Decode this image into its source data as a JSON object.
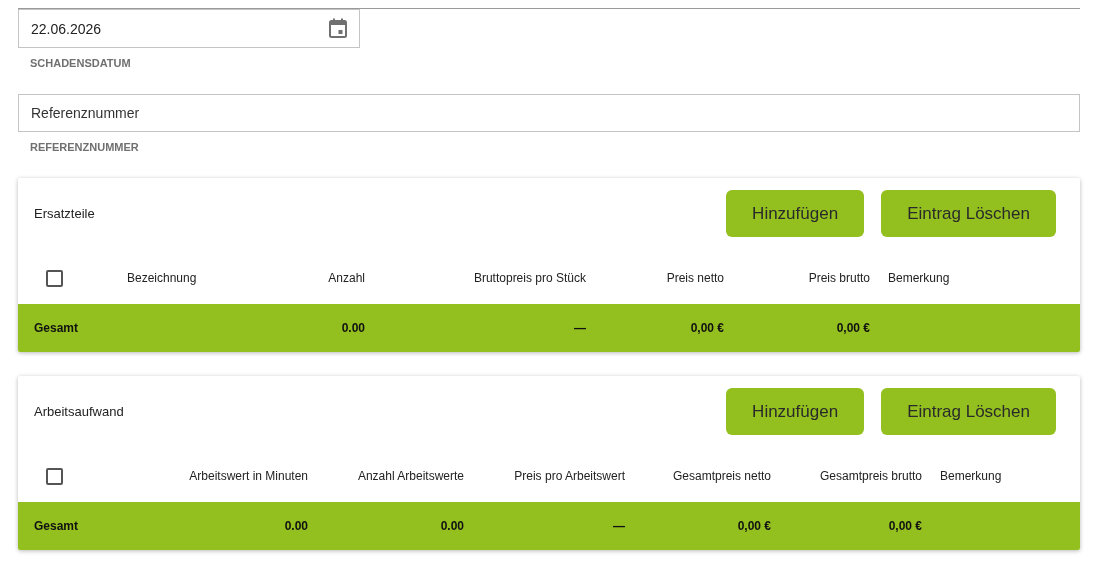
{
  "date_field": {
    "value": "22.06.2026",
    "label": "SCHADENSDATUM"
  },
  "reference_field": {
    "placeholder": "Referenznummer",
    "label": "REFERENZNUMMER"
  },
  "tables": [
    {
      "title": "Ersatzteile",
      "buttons": [
        "Hinzufügen",
        "Eintrag Löschen"
      ],
      "select_all_checked": false,
      "total_label": "Gesamt",
      "columns": [
        {
          "label": "Bezeichnung"
        },
        {
          "label": "Anzahl",
          "total": "0.00"
        },
        {
          "label": "Bruttopreis pro Stück",
          "total": "—"
        },
        {
          "label": "Preis netto",
          "total": "0,00 €"
        },
        {
          "label": "Preis brutto",
          "total": "0,00 €"
        },
        {
          "label": "Bemerkung"
        }
      ]
    },
    {
      "title": "Arbeitsaufwand",
      "buttons": [
        "Hinzufügen",
        "Eintrag Löschen"
      ],
      "select_all_checked": false,
      "total_label": "Gesamt",
      "columns": [
        {
          "label": "Arbeitswert in Minuten",
          "total": "0.00"
        },
        {
          "label": "Anzahl Arbeitswerte",
          "total": "0.00"
        },
        {
          "label": "Preis pro Arbeitswert",
          "total": "—"
        },
        {
          "label": "Gesamtpreis netto",
          "total": "0,00 €"
        },
        {
          "label": "Gesamtpreis brutto",
          "total": "0,00 €"
        },
        {
          "label": "Bemerkung"
        }
      ]
    }
  ]
}
